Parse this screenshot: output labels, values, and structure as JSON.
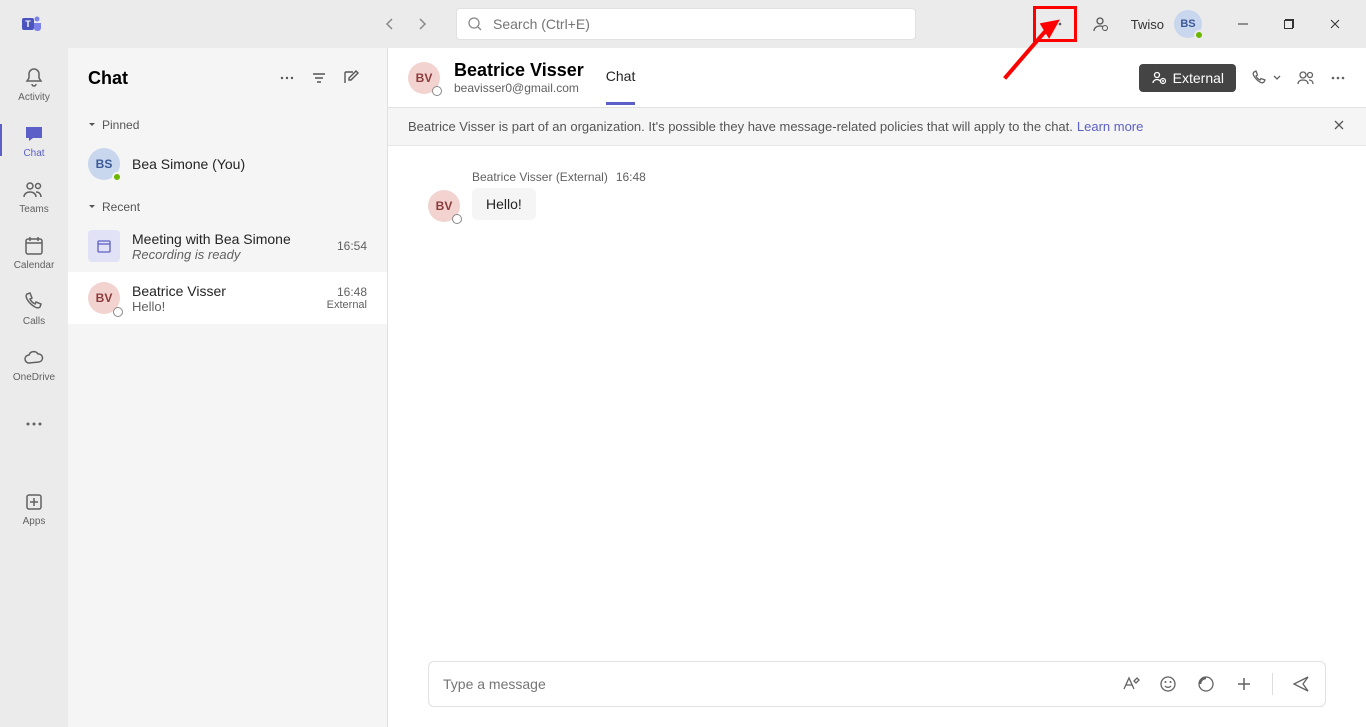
{
  "titlebar": {
    "search_placeholder": "Search (Ctrl+E)",
    "user_name": "Twiso",
    "user_initials": "BS"
  },
  "app_rail": {
    "activity": "Activity",
    "chat": "Chat",
    "teams": "Teams",
    "calendar": "Calendar",
    "calls": "Calls",
    "onedrive": "OneDrive",
    "apps": "Apps"
  },
  "chat_panel": {
    "title": "Chat",
    "sections": {
      "pinned": "Pinned",
      "recent": "Recent"
    },
    "pinned_items": [
      {
        "initials": "BS",
        "name": "Bea Simone (You)"
      }
    ],
    "recent_items": [
      {
        "kind": "meeting",
        "title": "Meeting with Bea Simone",
        "sub": "Recording is ready",
        "time": "16:54"
      },
      {
        "kind": "bv",
        "initials": "BV",
        "title": "Beatrice Visser",
        "sub": "Hello!",
        "time": "16:48",
        "tag": "External"
      }
    ]
  },
  "conv": {
    "initials": "BV",
    "title": "Beatrice Visser",
    "email": "beavisser0@gmail.com",
    "tab": "Chat",
    "external_btn": "External",
    "banner_text": "Beatrice Visser is part of an organization. It's possible they have message-related policies that will apply to the chat.",
    "banner_link": "Learn more",
    "messages": [
      {
        "initials": "BV",
        "sender": "Beatrice Visser (External)",
        "time": "16:48",
        "text": "Hello!"
      }
    ],
    "compose_placeholder": "Type a message"
  }
}
